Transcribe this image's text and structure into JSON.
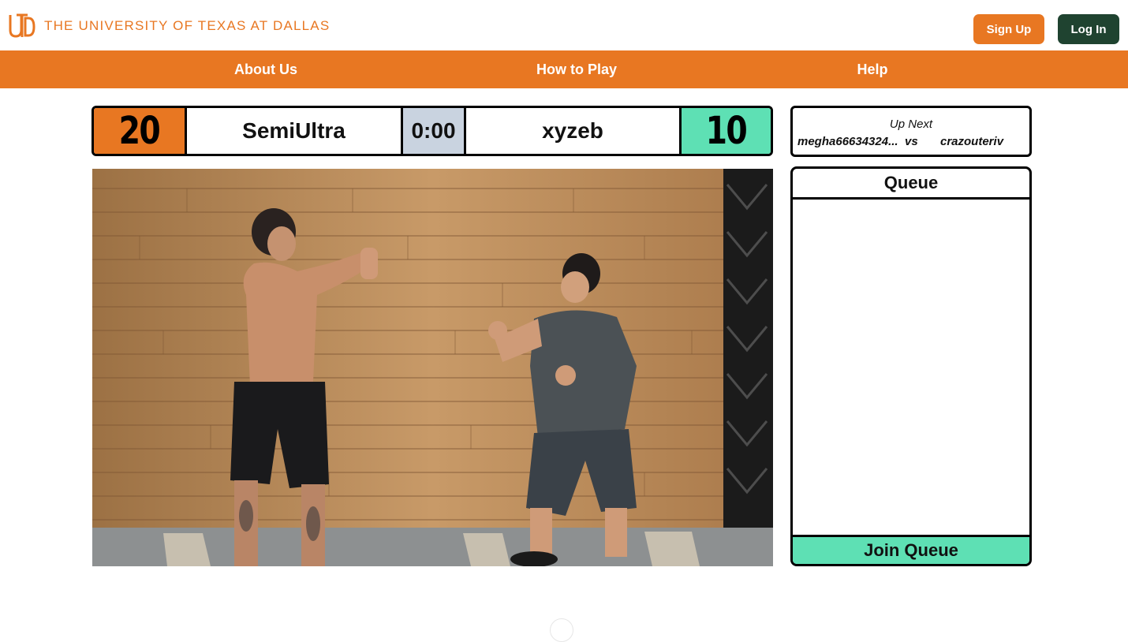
{
  "header": {
    "university_name": "THE UNIVERSITY OF TEXAS AT DALLAS",
    "logo_icon": "utd-logo-icon",
    "signup_label": "Sign Up",
    "login_label": "Log In"
  },
  "nav": {
    "items": [
      {
        "label": "About Us"
      },
      {
        "label": "How to Play"
      },
      {
        "label": "Help"
      }
    ]
  },
  "scoreboard": {
    "player1": {
      "name": "SemiUltra",
      "score": "20"
    },
    "timer": "0:00",
    "player2": {
      "name": "xyzeb",
      "score": "10"
    }
  },
  "up_next": {
    "title": "Up Next",
    "player1": "megha66634324...",
    "vs": "vs",
    "player2": "crazouteriv"
  },
  "queue": {
    "title": "Queue",
    "entries": [],
    "join_label": "Join Queue"
  },
  "video": {
    "description_icon": "live-match-video"
  },
  "colors": {
    "brand_orange": "#e87722",
    "brand_green": "#1f4330",
    "accent_mint": "#5ee0b4",
    "timer_bg": "#c9d3e0"
  }
}
